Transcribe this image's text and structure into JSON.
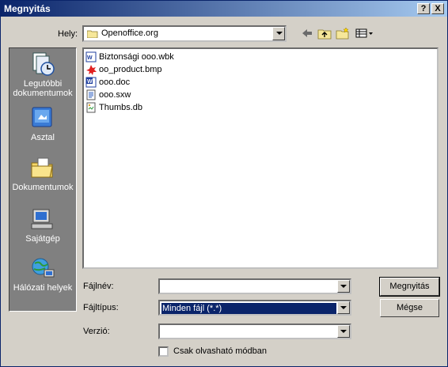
{
  "window": {
    "title": "Megnyitás",
    "help_label": "?",
    "close_label": "X"
  },
  "location": {
    "label": "Hely:",
    "value": "Openoffice.org"
  },
  "places": [
    {
      "label": "Legutóbbi dokumentumok"
    },
    {
      "label": "Asztal"
    },
    {
      "label": "Dokumentumok"
    },
    {
      "label": "Sajátgép"
    },
    {
      "label": "Hálózati helyek"
    }
  ],
  "files": [
    {
      "name": "Biztonsági ooo.wbk",
      "icon": "wbk-icon"
    },
    {
      "name": "oo_product.bmp",
      "icon": "bmp-icon"
    },
    {
      "name": "ooo.doc",
      "icon": "doc-icon"
    },
    {
      "name": "ooo.sxw",
      "icon": "sxw-icon"
    },
    {
      "name": "Thumbs.db",
      "icon": "db-icon"
    }
  ],
  "filename": {
    "label": "Fájlnév:",
    "value": ""
  },
  "filetype": {
    "label": "Fájltípus:",
    "value": "Minden fájl (*.*)"
  },
  "version": {
    "label": "Verzió:",
    "value": ""
  },
  "readonly": {
    "label": "Csak olvasható módban",
    "checked": false
  },
  "buttons": {
    "open": "Megnyitás",
    "cancel": "Mégse"
  }
}
